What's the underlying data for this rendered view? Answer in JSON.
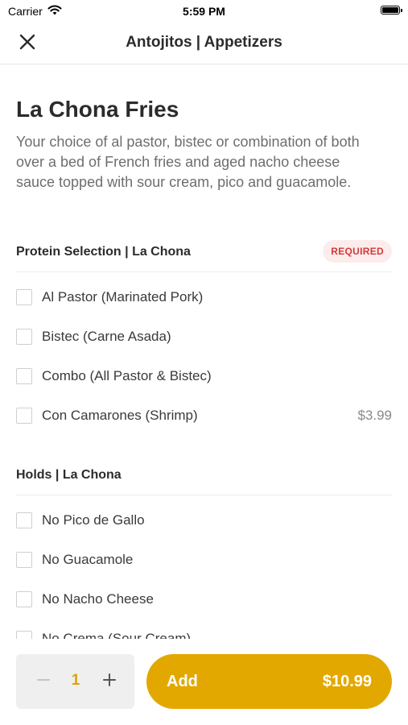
{
  "status_bar": {
    "carrier": "Carrier",
    "time": "5:59 PM"
  },
  "header": {
    "title": "Antojitos | Appetizers"
  },
  "item": {
    "name": "La Chona Fries",
    "description": "Your choice of al pastor, bistec or combination of both over a bed of French fries and aged nacho cheese sauce topped with sour cream, pico and guacamole."
  },
  "sections": [
    {
      "title": "Protein Selection | La Chona",
      "badge": "REQUIRED",
      "options": [
        {
          "label": "Al Pastor (Marinated Pork)",
          "price": "",
          "checked": false
        },
        {
          "label": "Bistec (Carne Asada)",
          "price": "",
          "checked": false
        },
        {
          "label": "Combo (All Pastor & Bistec)",
          "price": "",
          "checked": false
        },
        {
          "label": "Con Camarones (Shrimp)",
          "price": "$3.99",
          "checked": false
        }
      ]
    },
    {
      "title": "Holds | La Chona",
      "badge": "",
      "options": [
        {
          "label": "No Pico de Gallo",
          "price": "",
          "checked": false
        },
        {
          "label": "No Guacamole",
          "price": "",
          "checked": false
        },
        {
          "label": "No Nacho Cheese",
          "price": "",
          "checked": false
        },
        {
          "label": "No Crema (Sour Cream)",
          "price": "",
          "checked": false
        }
      ]
    }
  ],
  "footer": {
    "quantity": "1",
    "minus_symbol": "−",
    "plus_symbol": "+",
    "add_label": "Add",
    "total": "$10.99"
  },
  "colors": {
    "accent": "#e2a800",
    "quantity_text": "#d9a400",
    "badge_bg": "#fdecec",
    "badge_text": "#d23b3b"
  },
  "icons": {
    "close": "close-icon",
    "signal": "wifi-icon",
    "battery": "battery-icon",
    "minus": "minus-icon",
    "plus": "plus-icon"
  }
}
